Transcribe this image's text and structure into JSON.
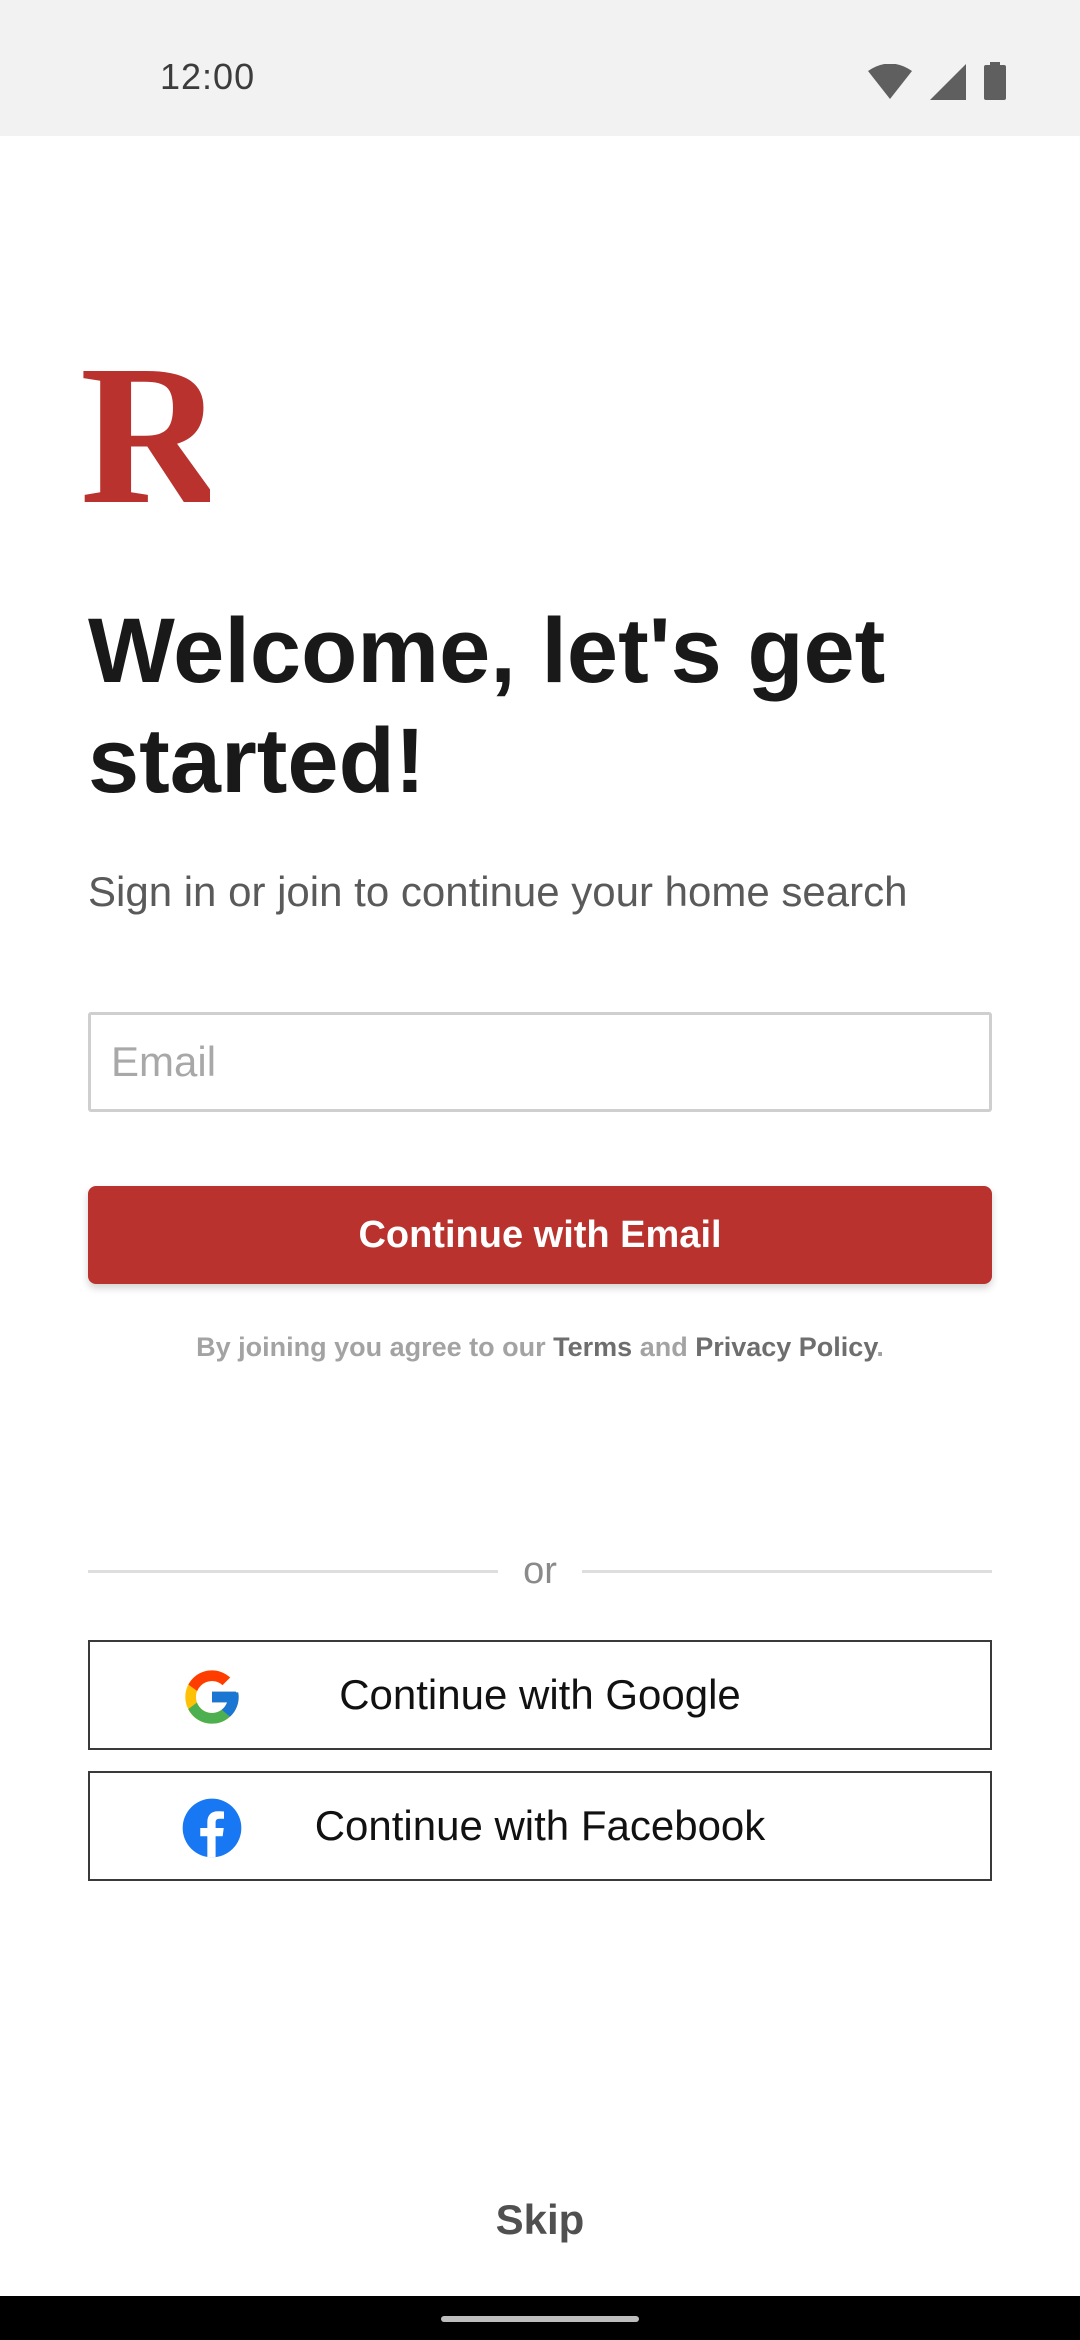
{
  "status_bar": {
    "time": "12:00",
    "icons": [
      "wifi-icon",
      "cellular-signal-icon",
      "battery-icon"
    ]
  },
  "brand": {
    "logo_letter": "R",
    "color": "#b9322d"
  },
  "welcome": {
    "title": "Welcome, let's get started!",
    "subtitle": "Sign in or join to continue your home search"
  },
  "email_form": {
    "placeholder": "Email",
    "value": "",
    "submit_label": "Continue with Email"
  },
  "legal": {
    "prefix": "By joining you agree to our ",
    "terms": "Terms",
    "conjunction": " and ",
    "privacy": "Privacy Policy",
    "suffix": "."
  },
  "divider": {
    "label": "or"
  },
  "social": {
    "google_label": "Continue with Google",
    "google_icon": "google-icon",
    "facebook_label": "Continue with Facebook",
    "facebook_icon": "facebook-icon",
    "facebook_color": "#1877f2"
  },
  "skip_label": "Skip"
}
